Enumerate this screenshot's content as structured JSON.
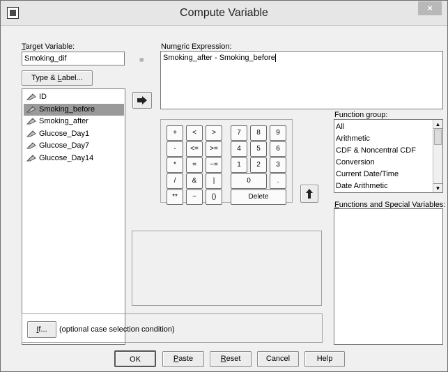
{
  "window": {
    "title": "Compute Variable",
    "close_glyph": "×"
  },
  "target": {
    "label": "Target Variable:",
    "value": "Smoking_dif",
    "equals": "=",
    "type_label_button": "Type & Label..."
  },
  "expression": {
    "label": "Numeric Expression:",
    "value": "Smoking_after - Smoking_before"
  },
  "variables": [
    "ID",
    "Smoking_before",
    "Smoking_after",
    "Glucose_Day1",
    "Glucose_Day7",
    "Glucose_Day14"
  ],
  "keypad": {
    "row1": [
      "+",
      "<",
      ">",
      "7",
      "8",
      "9"
    ],
    "row2": [
      "-",
      "<=",
      ">=",
      "4",
      "5",
      "6"
    ],
    "row3": [
      "*",
      "=",
      "~=",
      "1",
      "2",
      "3"
    ],
    "row4": [
      "/",
      "&",
      "|",
      "0",
      "."
    ],
    "row5": [
      "**",
      "~",
      "()",
      "Delete"
    ]
  },
  "function_group": {
    "label": "Function group:",
    "items": [
      "All",
      "Arithmetic",
      "CDF & Noncentral CDF",
      "Conversion",
      "Current Date/Time",
      "Date Arithmetic"
    ]
  },
  "functions_label": "Functions and Special Variables:",
  "if_button": {
    "label": "If...",
    "caption": "(optional case selection condition)"
  },
  "footer": {
    "ok": "OK",
    "paste": "Paste",
    "reset": "Reset",
    "cancel": "Cancel",
    "help": "Help"
  }
}
